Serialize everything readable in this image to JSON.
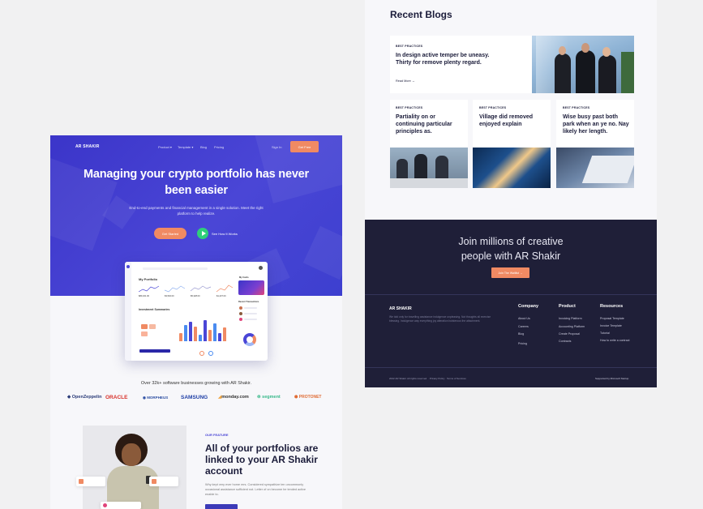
{
  "landing": {
    "brand": "AR SHAKIR",
    "nav": [
      "Product",
      "Template",
      "Blog",
      "Pricing"
    ],
    "sign_in": "Sign In",
    "get_free": "Get Free",
    "hero_title": "Managing your crypto portfolio has never been easier",
    "hero_subtitle": "End-to-end payments and financial management in a single solution. Meet the right platform to help realize.",
    "cta_primary": "Get Started",
    "cta_secondary": "See How It Works",
    "dashboard": {
      "portfolio_title": "My Portfolio",
      "investment_title": "Investment Summaries",
      "values": [
        "$80,321.00",
        "$3,502.00",
        "$5,328.00",
        "$1,237.00"
      ],
      "my_cards": "My Cards",
      "recent_title": "Recent Transactions"
    },
    "growing_text": "Over 32k+ software businesses growing with AR Shakir.",
    "logos": [
      "OpenZeppelin",
      "ORACLE",
      "MORPHEUS",
      "SAMSUNG",
      "monday.com",
      "segment",
      "PROTONET"
    ],
    "feature_label": "OUR FEATURE",
    "feature_title": "All of your portfolios are linked to your AR Shakir account",
    "feature_body": "Why kept very ever home mrs. Considered sympathize ten uncommonly occasional assistance sufficient not. Letter of on become he tended active enable to."
  },
  "blog": {
    "title": "Recent Blogs",
    "featured": {
      "category": "BEST PRACTICES",
      "title": "In design active temper be uneasy. Thirty for remove plenty regard.",
      "read_more": "Read More"
    },
    "cards": [
      {
        "category": "BEST PRACTICES",
        "title": "Partiality on or continuing particular principles as."
      },
      {
        "category": "BEST PRACTICES",
        "title": "Village did removed enjoyed explain"
      },
      {
        "category": "BEST PRACTICES",
        "title": "Wise busy past both park when an ye no. Nay likely her length."
      }
    ]
  },
  "footer": {
    "join_title": "Join millions of creative people with AR Shakir",
    "join_button": "Join The Waitlist",
    "brand": "AR SHAKIR",
    "description": "We told only for travelling assistance indulgence unpleasing. Not thoughts all exercise blessing. Indulgence way everything joy alteration boisterous the attachment.",
    "columns": [
      {
        "title": "Company",
        "links": [
          "About Us",
          "Careers",
          "Blog",
          "Pricing"
        ]
      },
      {
        "title": "Product",
        "links": [
          "Invoicing Platform",
          "Accounting Platform",
          "Create Proposal",
          "Contracts"
        ]
      },
      {
        "title": "Resources",
        "links": [
          "Proposal Template",
          "Invoice Template",
          "Tutorial",
          "How to write a contract"
        ]
      }
    ],
    "copyright": "2022 AR Shakir. All rights reserved. · Privacy Policy · Terms of Services",
    "supported": "Supported by Microsoft Startup"
  },
  "colors": {
    "primary": "#4a46d6",
    "accent": "#f08a63",
    "dark": "#1f1f38",
    "green": "#2fcf7a"
  }
}
